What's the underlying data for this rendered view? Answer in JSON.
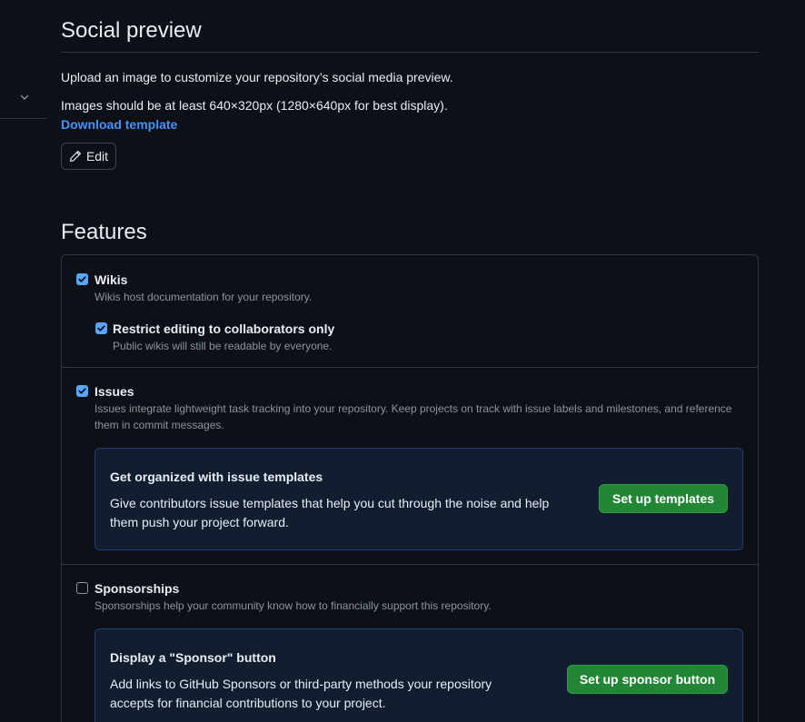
{
  "social_preview": {
    "title": "Social preview",
    "description": "Upload an image to customize your repository’s social media preview.",
    "size_hint": "Images should be at least 640×320px (1280×640px for best display).",
    "download_link": "Download template",
    "edit_label": "Edit"
  },
  "features": {
    "title": "Features",
    "wikis": {
      "label": "Wikis",
      "checked": true,
      "description": "Wikis host documentation for your repository.",
      "restrict": {
        "label": "Restrict editing to collaborators only",
        "checked": true,
        "description": "Public wikis will still be readable by everyone."
      }
    },
    "issues": {
      "label": "Issues",
      "checked": true,
      "description_line1": "Issues integrate lightweight task tracking into your repository. Keep projects on track with issue labels and milestones, and reference",
      "description_line2": "them in commit messages.",
      "promo": {
        "title": "Get organized with issue templates",
        "text_line1": "Give contributors issue templates that help you cut through the noise and help",
        "text_line2": "them push your project forward.",
        "button": "Set up templates"
      }
    },
    "sponsorships": {
      "label": "Sponsorships",
      "checked": false,
      "description": "Sponsorships help your community know how to financially support this repository.",
      "promo": {
        "title": "Display a \"Sponsor\" button",
        "text_line1": "Add links to GitHub Sponsors or third-party methods your repository",
        "text_line2": "accepts for financial contributions to your project.",
        "button": "Set up sponsor button"
      }
    }
  },
  "colors": {
    "background": "#0d1117",
    "border": "#30363d",
    "link": "#4493f8",
    "checkbox": "#58a6ff",
    "primary_button": "#238636",
    "promo_background": "#121d2f"
  },
  "icons": {
    "side_toggle": "chevron-down-icon",
    "edit": "pencil-icon",
    "checkbox": "check-icon"
  }
}
